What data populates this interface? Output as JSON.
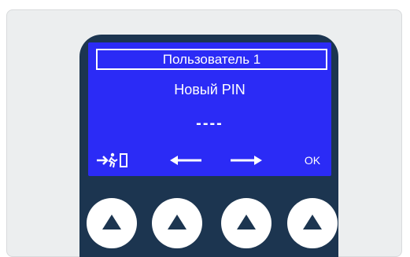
{
  "display": {
    "user_label": "Пользователь 1",
    "title": "Новый PIN",
    "pin_placeholder": "----",
    "softkeys": {
      "exit_icon": "exit-icon",
      "left_icon": "arrow-left-icon",
      "right_icon": "arrow-right-icon",
      "ok_label": "OK"
    }
  },
  "colors": {
    "screen": "#2b2bf6",
    "device_body": "#1c3550",
    "background_panel": "#eceeef"
  }
}
